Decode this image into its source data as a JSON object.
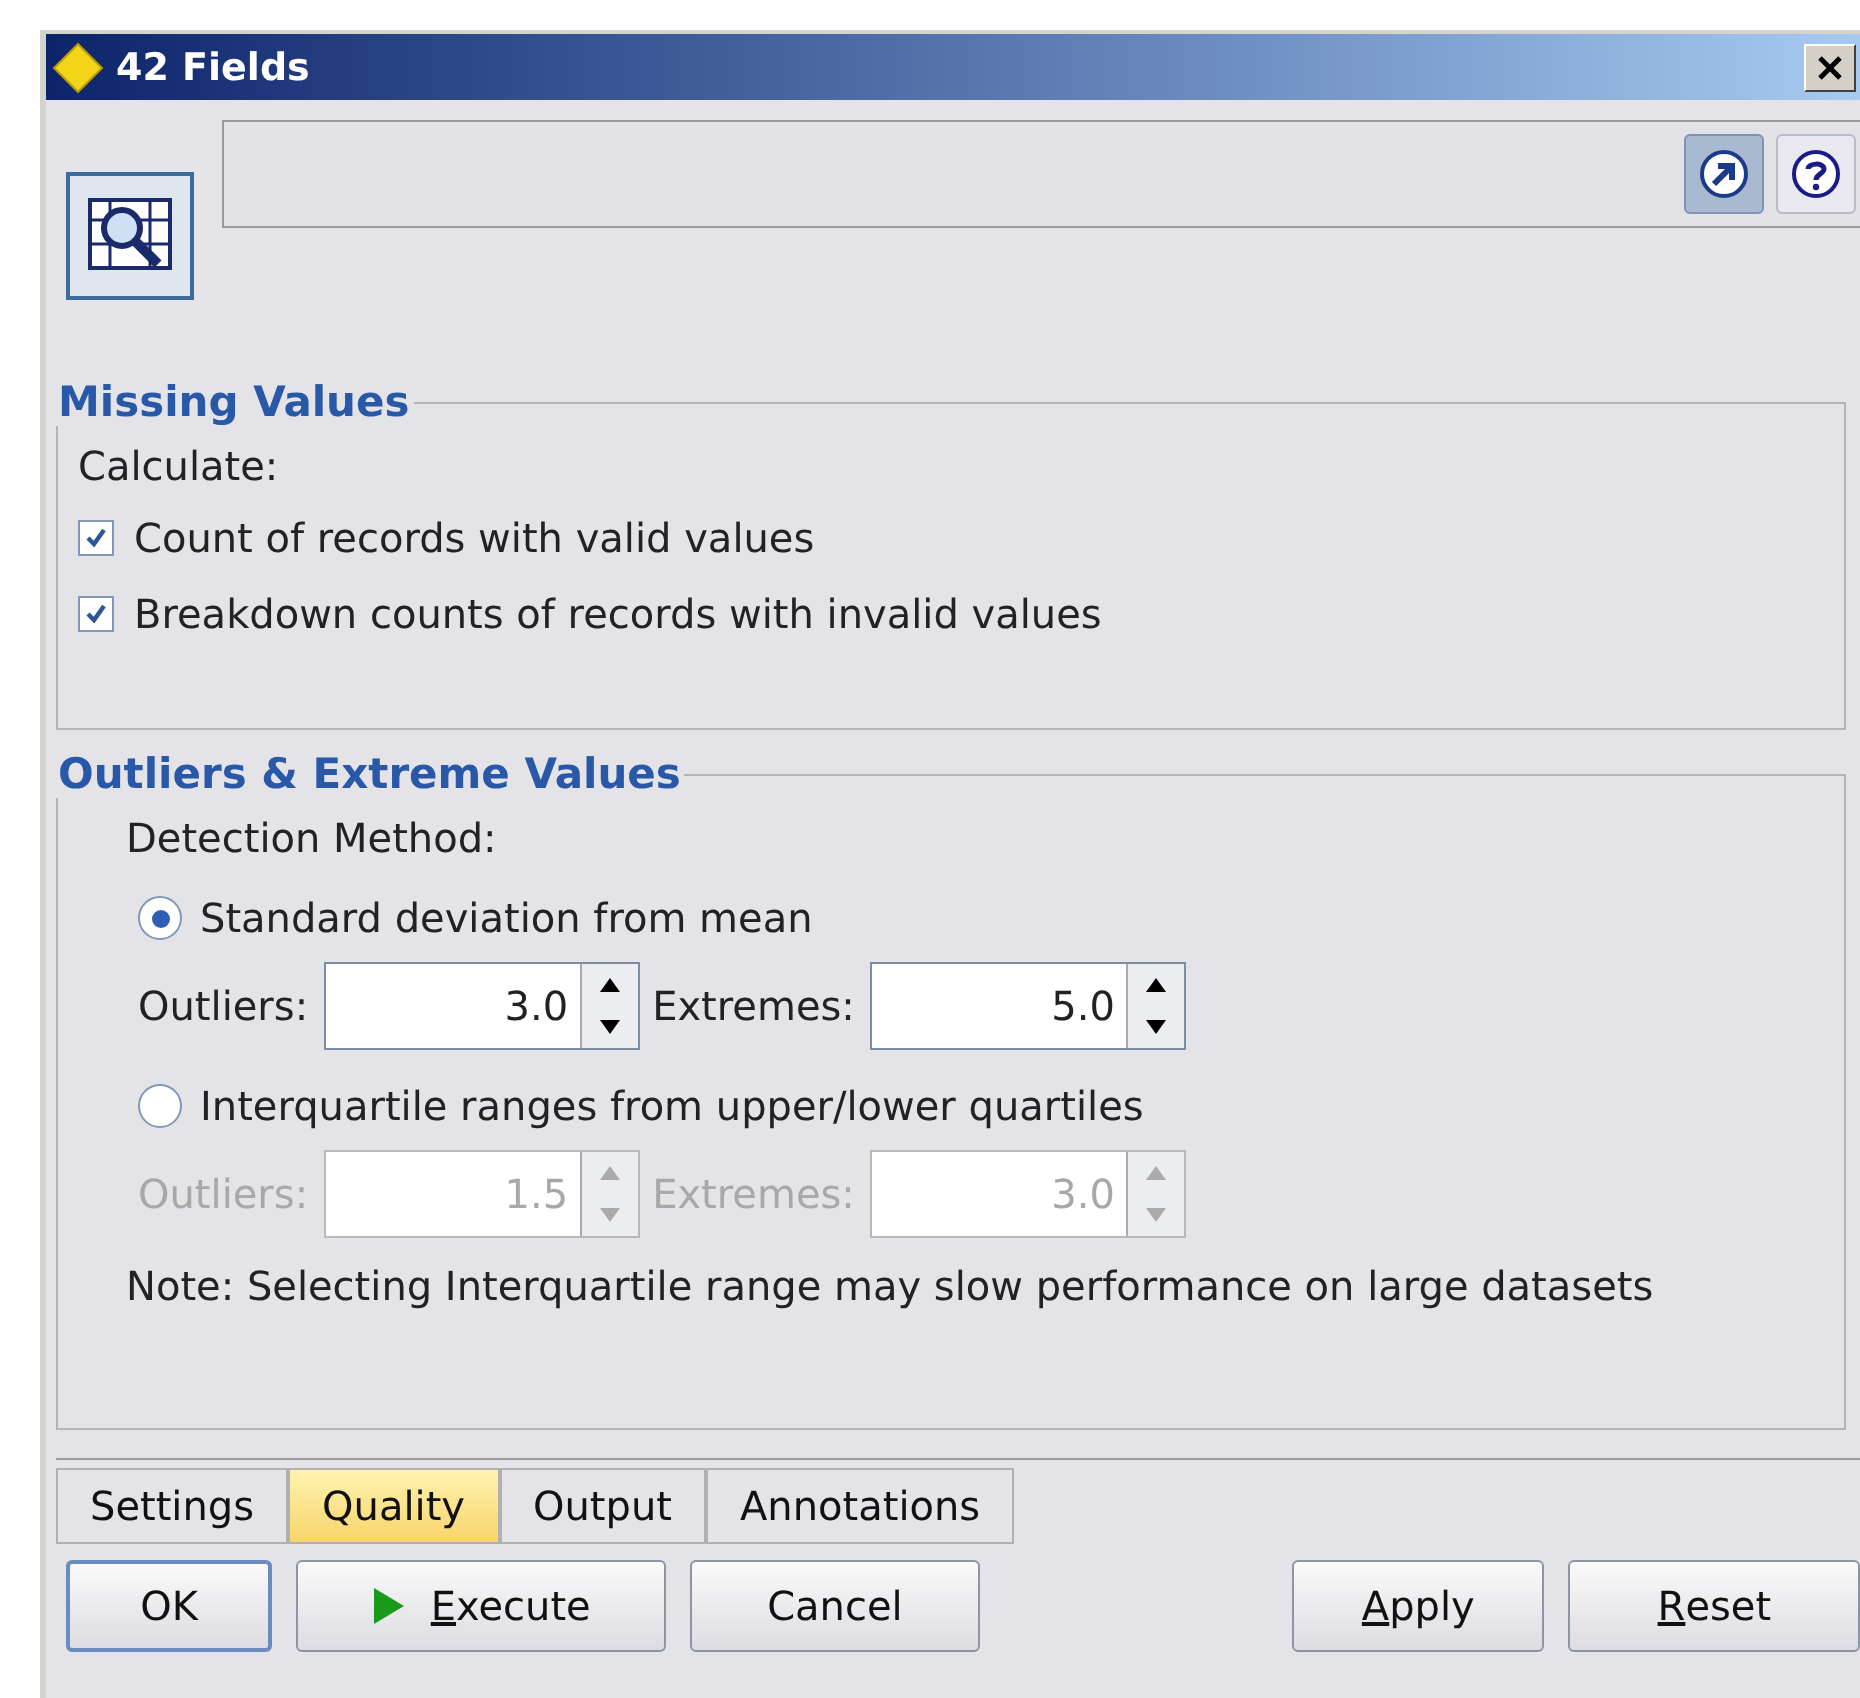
{
  "window": {
    "title": "42 Fields"
  },
  "missing_values": {
    "title": "Missing Values",
    "label": "Calculate:",
    "options": [
      {
        "label": "Count of records with valid values",
        "checked": true
      },
      {
        "label": "Breakdown counts of records with invalid values",
        "checked": true
      }
    ]
  },
  "outliers": {
    "title": "Outliers & Extreme Values",
    "label": "Detection Method:",
    "methods": [
      {
        "label": "Standard deviation from mean",
        "selected": true,
        "disabled": false,
        "fields": [
          {
            "label": "Outliers:",
            "value": "3.0"
          },
          {
            "label": "Extremes:",
            "value": "5.0"
          }
        ]
      },
      {
        "label": "Interquartile ranges from upper/lower quartiles",
        "selected": false,
        "disabled": true,
        "fields": [
          {
            "label": "Outliers:",
            "value": "1.5"
          },
          {
            "label": "Extremes:",
            "value": "3.0"
          }
        ]
      }
    ],
    "note": "Note: Selecting Interquartile range may slow performance on large datasets"
  },
  "tabs": [
    {
      "label": "Settings",
      "selected": false
    },
    {
      "label": "Quality",
      "selected": true
    },
    {
      "label": "Output",
      "selected": false
    },
    {
      "label": "Annotations",
      "selected": false
    }
  ],
  "buttons": [
    {
      "kind": "default",
      "rest": "OK"
    },
    {
      "kind": "execute",
      "mnemonic": "E",
      "rest": "xecute"
    },
    {
      "kind": "plain",
      "rest": "Cancel"
    },
    {
      "kind": "plain",
      "mnemonic": "A",
      "rest": "pply"
    },
    {
      "kind": "plain",
      "mnemonic": "R",
      "rest": "eset"
    }
  ]
}
